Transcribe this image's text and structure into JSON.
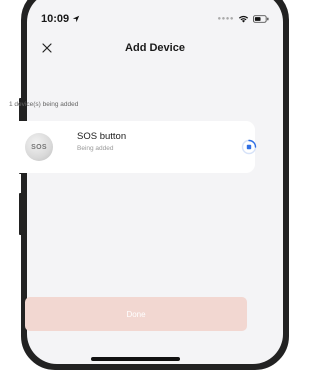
{
  "status_bar": {
    "time": "10:09",
    "icons": [
      "location-arrow-icon",
      "signal-dots-icon",
      "wifi-icon",
      "battery-icon"
    ]
  },
  "nav": {
    "title": "Add Device",
    "close_icon": "close-icon"
  },
  "summary": {
    "count_text": "1 device(s) being added"
  },
  "device": {
    "thumbnail_label": "SOS",
    "name": "SOS button",
    "status": "Being added",
    "progress_icon": "progress-spinner-icon"
  },
  "actions": {
    "done_label": "Done"
  },
  "colors": {
    "background": "#f4f4f6",
    "card": "#ffffff",
    "accent_blue": "#2f6fe4",
    "done_disabled": "#f2d7d1"
  }
}
